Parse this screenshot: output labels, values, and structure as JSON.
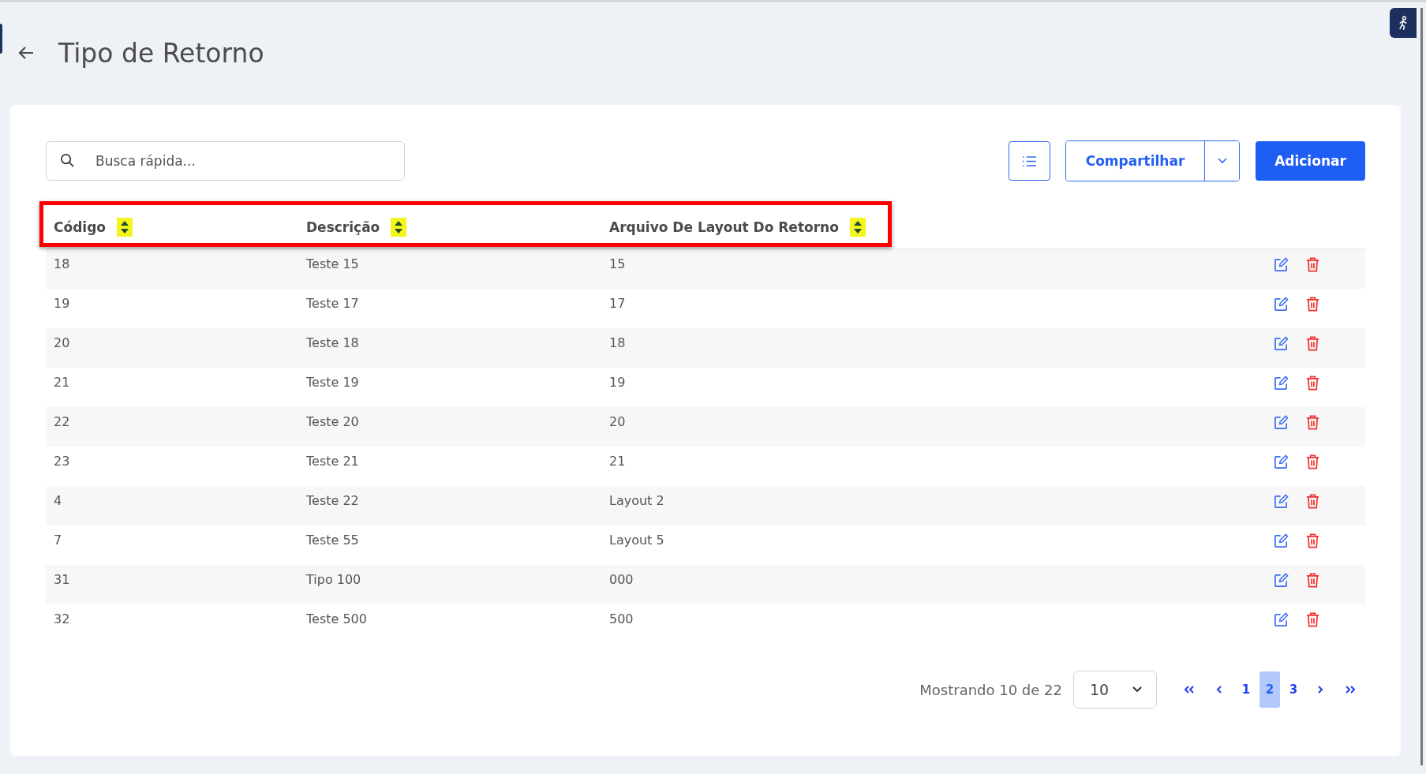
{
  "page": {
    "title": "Tipo de Retorno"
  },
  "toolbar": {
    "search": {
      "placeholder": "Busca rápida..."
    },
    "share_button": "Compartilhar",
    "add_button": "Adicionar"
  },
  "table": {
    "columns": [
      "Código",
      "Descrição",
      "Arquivo De Layout Do Retorno"
    ],
    "rows": [
      {
        "cells": [
          "18",
          "Teste 15",
          "15"
        ]
      },
      {
        "cells": [
          "19",
          "Teste 17",
          "17"
        ]
      },
      {
        "cells": [
          "20",
          "Teste 18",
          "18"
        ]
      },
      {
        "cells": [
          "21",
          "Teste 19",
          "19"
        ]
      },
      {
        "cells": [
          "22",
          "Teste 20",
          "20"
        ]
      },
      {
        "cells": [
          "23",
          "Teste 21",
          "21"
        ]
      },
      {
        "cells": [
          "4",
          "Teste 22",
          "Layout 2"
        ]
      },
      {
        "cells": [
          "7",
          "Teste 55",
          "Layout 5"
        ]
      },
      {
        "cells": [
          "31",
          "Tipo 100",
          "000"
        ]
      },
      {
        "cells": [
          "32",
          "Teste 500",
          "500"
        ]
      }
    ]
  },
  "pagination": {
    "summary": "Mostrando 10 de 22",
    "page_size": "10",
    "pages": [
      {
        "label": "1",
        "selected": false
      },
      {
        "label": "2",
        "selected": true
      },
      {
        "label": "3",
        "selected": false
      }
    ]
  }
}
